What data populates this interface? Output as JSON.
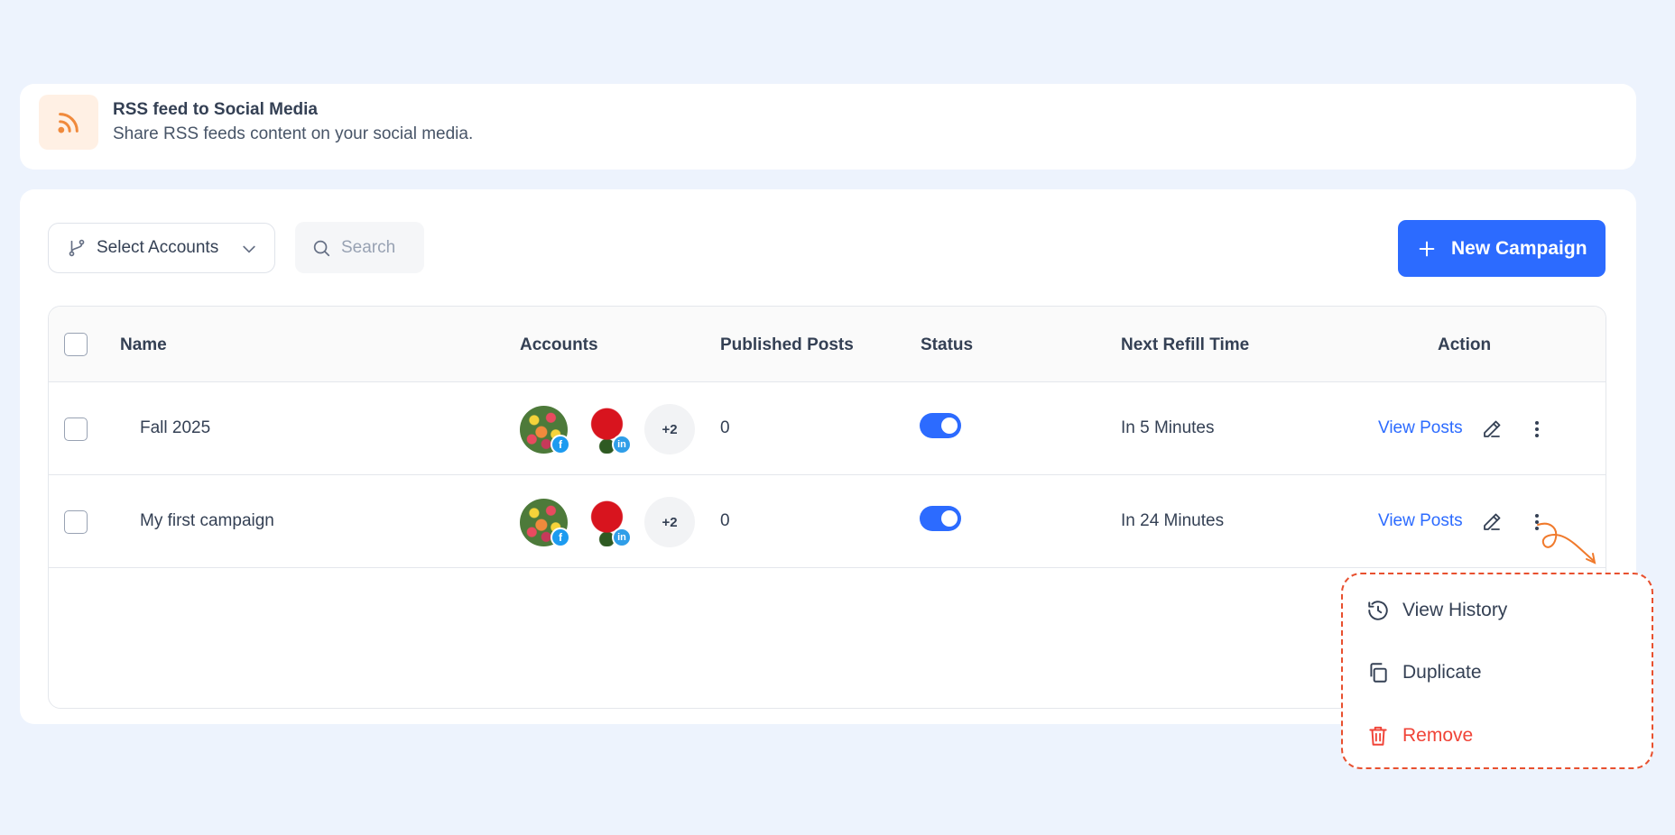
{
  "header": {
    "title": "RSS feed to Social Media",
    "subtitle": "Share RSS feeds content on your social media.",
    "icon": "rss-icon",
    "accent": "#f08a3c"
  },
  "toolbar": {
    "select_accounts_label": "Select Accounts",
    "search_placeholder": "Search",
    "new_campaign_label": "New Campaign"
  },
  "table": {
    "columns": {
      "name": "Name",
      "accounts": "Accounts",
      "published_posts": "Published Posts",
      "status": "Status",
      "next_refill_time": "Next Refill Time",
      "action": "Action"
    },
    "rows": [
      {
        "name": "Fall 2025",
        "accounts_extra": "+2",
        "published_posts": "0",
        "status_enabled": true,
        "next_refill_time": "In 5 Minutes",
        "view_posts_label": "View Posts"
      },
      {
        "name": "My first campaign",
        "accounts_extra": "+2",
        "published_posts": "0",
        "status_enabled": true,
        "next_refill_time": "In 24 Minutes",
        "view_posts_label": "View Posts"
      }
    ]
  },
  "menu": {
    "items": [
      {
        "label": "View History",
        "icon": "history-icon"
      },
      {
        "label": "Duplicate",
        "icon": "copy-icon"
      },
      {
        "label": "Remove",
        "icon": "trash-icon",
        "color": "#f04438"
      }
    ]
  },
  "colors": {
    "primary": "#2c6bff",
    "background": "#edf3fd",
    "danger": "#f04438",
    "highlight_border": "#e8502f"
  }
}
